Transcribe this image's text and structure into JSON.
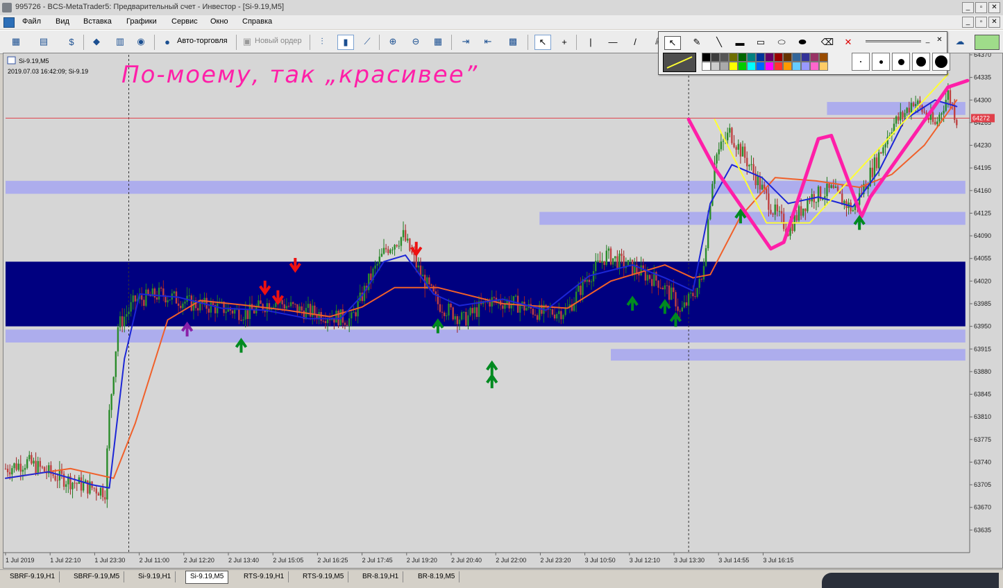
{
  "window": {
    "title": "995726 - BCS-MetaTrader5: Предварительный счет - Инвестор - [Si-9.19,M5]",
    "controls": [
      "_",
      "▫",
      "✕"
    ]
  },
  "menu": {
    "items": [
      "Файл",
      "Вид",
      "Вставка",
      "Графики",
      "Сервис",
      "Окно",
      "Справка"
    ]
  },
  "toolbar": {
    "autotrade_label": "Авто-торговля",
    "neworder_label": "Новый ордер"
  },
  "palette": {
    "colors": [
      "#000000",
      "#3c3c3c",
      "#555555",
      "#6e6e00",
      "#006600",
      "#008080",
      "#003399",
      "#660066",
      "#990000",
      "#663300",
      "#336699",
      "#333399",
      "#993366",
      "#994c00",
      "#ffffff",
      "#cccccc",
      "#aaaaaa",
      "#ffff00",
      "#00cc00",
      "#00ffff",
      "#0066ff",
      "#ff00ff",
      "#ff3333",
      "#ff9900",
      "#66ccff",
      "#9999ff",
      "#ff66cc",
      "#ffcc66"
    ]
  },
  "colors": {
    "chart_bg": "#d6d6d6",
    "ma_fast": "#1c26d6",
    "ma_slow": "#f0602a",
    "zone_dark": "#000080",
    "zone_light": "#a8a8f0",
    "price_line": "#e0404a",
    "annotation": "#ff1fa8",
    "drawn_line": "#ffff33",
    "up_arrow": "#008a20",
    "down_arrow": "#ee1111"
  },
  "chart_data": {
    "type": "candlestick",
    "symbol_label": "Si-9.19,M5",
    "info_line": "2019.07.03 16:42:09; Si-9.19",
    "annotation": "По-моему, так „красивее”",
    "current_price_label": "64272",
    "ylim": [
      63600,
      64370
    ],
    "y_ticks": [
      "64370",
      "64335",
      "64300",
      "64265",
      "64230",
      "64195",
      "64160",
      "64125",
      "64090",
      "64055",
      "64020",
      "63985",
      "63950",
      "63915",
      "63880",
      "63845",
      "63810",
      "63775",
      "63740",
      "63705",
      "63670",
      "63635"
    ],
    "x_ticks": [
      "1 Jul 2019",
      "1 Jul 22:10",
      "1 Jul 23:30",
      "2 Jul 11:00",
      "2 Jul 12:20",
      "2 Jul 13:40",
      "2 Jul 15:05",
      "2 Jul 16:25",
      "2 Jul 17:45",
      "2 Jul 19:20",
      "2 Jul 20:40",
      "2 Jul 22:00",
      "2 Jul 23:20",
      "3 Jul 10:50",
      "3 Jul 12:10",
      "3 Jul 13:30",
      "3 Jul 14:55",
      "3 Jul 16:15"
    ],
    "close_path": [
      [
        0,
        63730
      ],
      [
        10,
        63740
      ],
      [
        22,
        63720
      ],
      [
        35,
        63705
      ],
      [
        46,
        63695
      ],
      [
        48,
        63815
      ],
      [
        52,
        63950
      ],
      [
        60,
        63990
      ],
      [
        72,
        64000
      ],
      [
        86,
        63985
      ],
      [
        100,
        63978
      ],
      [
        112,
        63970
      ],
      [
        124,
        63990
      ],
      [
        136,
        63975
      ],
      [
        148,
        63968
      ],
      [
        160,
        63960
      ],
      [
        168,
        64020
      ],
      [
        176,
        64070
      ],
      [
        184,
        64090
      ],
      [
        192,
        64030
      ],
      [
        200,
        63985
      ],
      [
        212,
        63960
      ],
      [
        224,
        63990
      ],
      [
        236,
        63985
      ],
      [
        248,
        63970
      ],
      [
        260,
        63975
      ],
      [
        268,
        64020
      ],
      [
        278,
        64060
      ],
      [
        290,
        64040
      ],
      [
        302,
        64020
      ],
      [
        310,
        63990
      ],
      [
        312,
        63970
      ],
      [
        322,
        64020
      ],
      [
        328,
        64210
      ],
      [
        335,
        64250
      ],
      [
        344,
        64200
      ],
      [
        355,
        64130
      ],
      [
        362,
        64100
      ],
      [
        372,
        64150
      ],
      [
        382,
        64160
      ],
      [
        392,
        64130
      ],
      [
        402,
        64200
      ],
      [
        410,
        64260
      ],
      [
        416,
        64280
      ],
      [
        420,
        64300
      ],
      [
        430,
        64260
      ],
      [
        436,
        64310
      ],
      [
        440,
        64270
      ]
    ],
    "ma_fast": [
      [
        0,
        63715
      ],
      [
        20,
        63725
      ],
      [
        40,
        63705
      ],
      [
        48,
        63700
      ],
      [
        55,
        63900
      ],
      [
        62,
        64000
      ],
      [
        80,
        63995
      ],
      [
        100,
        63978
      ],
      [
        120,
        63975
      ],
      [
        140,
        63962
      ],
      [
        155,
        63962
      ],
      [
        165,
        63998
      ],
      [
        175,
        64050
      ],
      [
        185,
        64060
      ],
      [
        198,
        64000
      ],
      [
        210,
        63982
      ],
      [
        230,
        63992
      ],
      [
        250,
        63975
      ],
      [
        270,
        64028
      ],
      [
        290,
        64045
      ],
      [
        305,
        64025
      ],
      [
        318,
        64005
      ],
      [
        326,
        64140
      ],
      [
        336,
        64200
      ],
      [
        350,
        64180
      ],
      [
        362,
        64140
      ],
      [
        376,
        64150
      ],
      [
        392,
        64135
      ],
      [
        404,
        64190
      ],
      [
        416,
        64270
      ],
      [
        430,
        64300
      ],
      [
        440,
        64290
      ]
    ],
    "ma_slow": [
      [
        0,
        63715
      ],
      [
        30,
        63730
      ],
      [
        50,
        63715
      ],
      [
        60,
        63800
      ],
      [
        75,
        63960
      ],
      [
        90,
        63990
      ],
      [
        110,
        63983
      ],
      [
        130,
        63975
      ],
      [
        150,
        63965
      ],
      [
        165,
        63980
      ],
      [
        180,
        64010
      ],
      [
        200,
        64010
      ],
      [
        230,
        63985
      ],
      [
        260,
        63978
      ],
      [
        280,
        64020
      ],
      [
        305,
        64045
      ],
      [
        318,
        64025
      ],
      [
        326,
        64030
      ],
      [
        340,
        64120
      ],
      [
        356,
        64180
      ],
      [
        375,
        64175
      ],
      [
        395,
        64165
      ],
      [
        410,
        64185
      ],
      [
        425,
        64230
      ],
      [
        440,
        64300
      ]
    ],
    "zones": [
      {
        "kind": "dark",
        "x0": 0,
        "x1": 444,
        "y0": 63950,
        "y1": 64050
      },
      {
        "kind": "light",
        "x0": 0,
        "x1": 444,
        "y0": 63925,
        "y1": 63945
      },
      {
        "kind": "light",
        "x0": 0,
        "x1": 444,
        "y0": 64155,
        "y1": 64175
      },
      {
        "kind": "light",
        "x0": 247,
        "x1": 444,
        "y0": 64107,
        "y1": 64127
      },
      {
        "kind": "light",
        "x0": 280,
        "x1": 444,
        "y0": 63897,
        "y1": 63915
      },
      {
        "kind": "light",
        "x0": 380,
        "x1": 444,
        "y0": 64277,
        "y1": 64297
      }
    ],
    "up_arrows": [
      [
        109,
        63920
      ],
      [
        200,
        63950
      ],
      [
        225,
        63885
      ],
      [
        225,
        63865
      ],
      [
        290,
        63985
      ],
      [
        305,
        63980
      ],
      [
        310,
        63960
      ],
      [
        340,
        64120
      ],
      [
        395,
        64110
      ]
    ],
    "down_arrows": [
      [
        190,
        64070
      ],
      [
        120,
        64010
      ],
      [
        126,
        63995
      ],
      [
        134,
        64045
      ]
    ],
    "purple_arrows": [
      [
        84,
        63945
      ]
    ],
    "drawn_yellow": [
      [
        328,
        64270
      ],
      [
        352,
        64110
      ],
      [
        372,
        64110
      ],
      [
        436,
        64340
      ]
    ],
    "annotation_stroke": [
      [
        316,
        64270
      ],
      [
        328,
        64195
      ],
      [
        354,
        64070
      ],
      [
        360,
        64080
      ],
      [
        376,
        64240
      ],
      [
        382,
        64245
      ],
      [
        396,
        64120
      ],
      [
        400,
        64150
      ],
      [
        436,
        64320
      ],
      [
        445,
        64330
      ]
    ],
    "vlines": [
      57,
      316
    ]
  }
}
